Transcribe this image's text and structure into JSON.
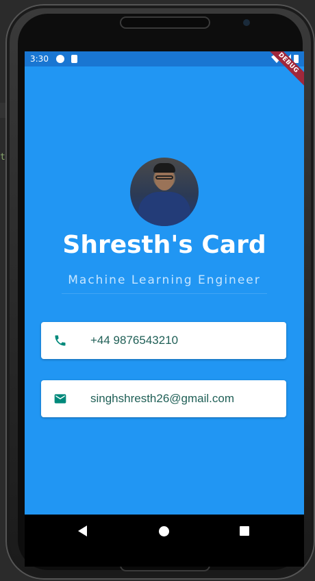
{
  "status_bar": {
    "time": "3:30",
    "debug_label": "DEBUG"
  },
  "profile": {
    "name": "Shresth's Card",
    "title": "Machine Learning Engineer"
  },
  "contacts": {
    "phone": "+44 9876543210",
    "email": "singhshresth26@gmail.com"
  },
  "ide": {
    "fragment": "te"
  },
  "colors": {
    "background": "#2196f3",
    "status_bar": "#1976d2",
    "card_text": "#1f5f56",
    "icon": "#00897b"
  },
  "icons": {
    "phone": "phone-icon",
    "email": "mail-icon"
  }
}
